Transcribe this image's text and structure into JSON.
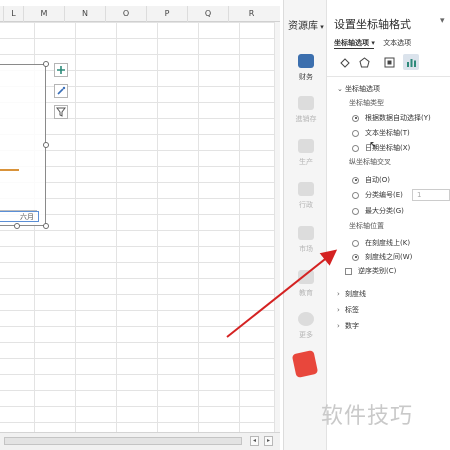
{
  "spreadsheet": {
    "columns": [
      "L",
      "M",
      "N",
      "O",
      "P",
      "Q",
      "R"
    ],
    "chart_axis_label": "六月"
  },
  "resource_bar": {
    "title": "资源库",
    "items": [
      {
        "label": "财务",
        "icon": "wallet-icon"
      },
      {
        "label": "進销存",
        "icon": "inventory-icon"
      },
      {
        "label": "生产",
        "icon": "production-icon"
      },
      {
        "label": "行政",
        "icon": "admin-icon"
      },
      {
        "label": "市场",
        "icon": "market-icon"
      },
      {
        "label": "教育",
        "icon": "education-icon"
      },
      {
        "label": "更多",
        "icon": "more-icon"
      }
    ]
  },
  "pane": {
    "title": "设置坐标轴格式",
    "tabs": [
      "坐标轴选项",
      "文本选项"
    ],
    "format_icons": [
      "fill-icon",
      "effects-icon",
      "size-properties-icon",
      "axis-options-icon"
    ],
    "axis_options": {
      "section": "坐标轴选项",
      "axis_type_label": "坐标轴类型",
      "axis_type_options": [
        {
          "label": "根据数据自动选择(Y)",
          "checked": true
        },
        {
          "label": "文本坐标轴(T)",
          "checked": false
        },
        {
          "label": "日期坐标轴(X)",
          "checked": false
        }
      ],
      "vertical_cross_label": "纵坐标轴交叉",
      "vertical_cross_options": [
        {
          "label": "自动(O)",
          "checked": true
        },
        {
          "label": "分类编号(E)",
          "checked": false
        },
        {
          "label": "最大分类(G)",
          "checked": false
        }
      ],
      "category_number_value": "1",
      "position_label": "坐标轴位置",
      "position_options": [
        {
          "label": "在刻度线上(K)",
          "checked": false
        },
        {
          "label": "刻度线之间(W)",
          "checked": true
        }
      ],
      "reverse_order_label": "逆序类别(C)",
      "reverse_order_checked": false
    },
    "collapsed_sections": [
      "刻度线",
      "标签",
      "数字"
    ]
  },
  "watermark": "软件技巧",
  "colors": {
    "accent": "#2d8a7a",
    "arrow": "#d42222",
    "chart_line": "#d9933a"
  }
}
